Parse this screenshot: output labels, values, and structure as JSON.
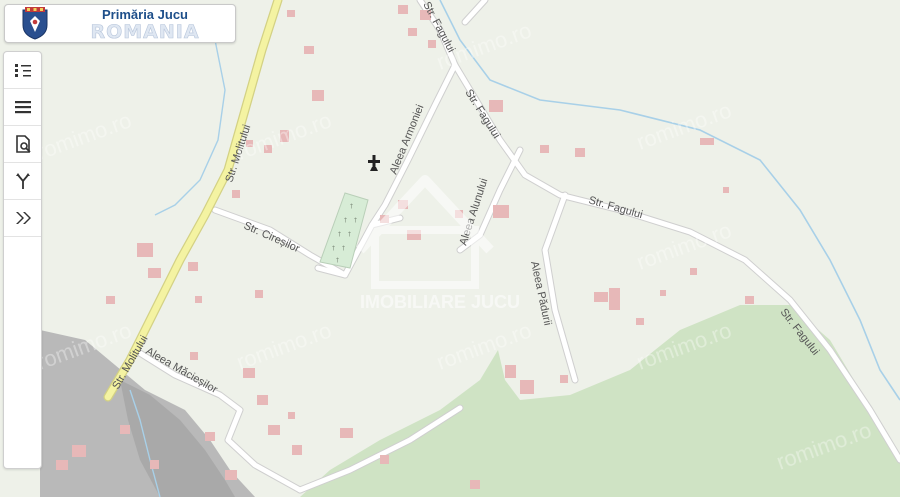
{
  "header": {
    "title": "Primăria Jucu",
    "subtitle": "ROMANIA",
    "crest_icon": "coat-of-arms-icon"
  },
  "toolbar": {
    "buttons": [
      {
        "name": "legend-list-button",
        "icon": "list-legend-icon"
      },
      {
        "name": "layers-menu-button",
        "icon": "hamburger-menu-icon"
      },
      {
        "name": "document-search-button",
        "icon": "document-search-icon"
      },
      {
        "name": "route-button",
        "icon": "route-fork-icon"
      },
      {
        "name": "expand-panel-button",
        "icon": "double-chevron-right-icon"
      }
    ]
  },
  "streets": {
    "molitului_upper": "Str. Molitului",
    "molitului_lower": "Str. Molitului",
    "ciresilor": "Str. Cireșilor",
    "maciesilor": "Aleea Măcieșilor",
    "armoniei": "Aleea Armoniei",
    "fagului_top": "Str. Fagului",
    "fagului_upper": "Str. Fagului",
    "fagului_middle": "Str. Fagului",
    "fagului_lower": "Str. Fagului",
    "alunului": "Aleea Alunului",
    "padurii": "Aleea Pădurii"
  },
  "watermarks": {
    "site": "romimo.ro",
    "brand": "IMOBILIARE JUCU"
  },
  "poi": {
    "cemetery_icon": "cemetery-cross-icon"
  },
  "colors": {
    "background": "#eef1e9",
    "main_road": "#f4f3a2",
    "main_road_casing": "#d3d184",
    "minor_road": "#ffffff",
    "road_casing": "#cfcfcf",
    "building": "#e7b8b8",
    "forest": "#cfe3c4",
    "river": "#a8d0e8",
    "quarry": "#b8b8b8",
    "header_title": "#1e4f8a"
  }
}
